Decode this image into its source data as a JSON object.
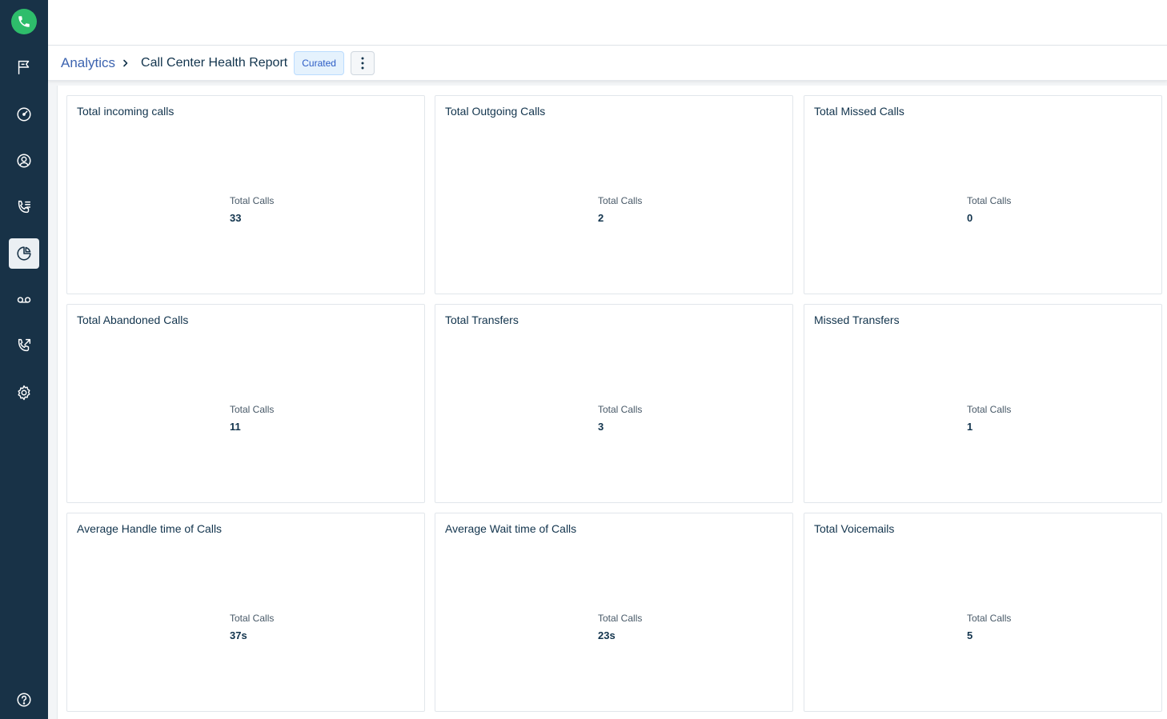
{
  "sidebar": {
    "items": [
      {
        "icon": "flag-icon"
      },
      {
        "icon": "speedometer-icon"
      },
      {
        "icon": "contact-icon"
      },
      {
        "icon": "call-log-icon"
      },
      {
        "icon": "analytics-pie-icon",
        "active": true
      },
      {
        "icon": "voicemail-icon"
      },
      {
        "icon": "call-transfer-icon"
      },
      {
        "icon": "gear-icon"
      }
    ],
    "help_icon": "help-icon"
  },
  "breadcrumb": {
    "parent": "Analytics",
    "current": "Call Center Health Report",
    "badge": "Curated"
  },
  "cards": [
    {
      "title": "Total incoming calls",
      "label": "Total Calls",
      "value": "33"
    },
    {
      "title": "Total Outgoing Calls",
      "label": "Total Calls",
      "value": "2"
    },
    {
      "title": "Total Missed Calls",
      "label": "Total Calls",
      "value": "0"
    },
    {
      "title": "Total Abandoned Calls",
      "label": "Total Calls",
      "value": "11"
    },
    {
      "title": "Total Transfers",
      "label": "Total Calls",
      "value": "3"
    },
    {
      "title": "Missed Transfers",
      "label": "Total Calls",
      "value": "1"
    },
    {
      "title": "Average Handle time of Calls",
      "label": "Total Calls",
      "value": "37s"
    },
    {
      "title": "Average Wait time of Calls",
      "label": "Total Calls",
      "value": "23s"
    },
    {
      "title": "Total Voicemails",
      "label": "Total Calls",
      "value": "5"
    }
  ],
  "colors": {
    "sidebar": "#183247",
    "brand_green": "#2ebd6b",
    "link": "#3d64b0",
    "text": "#12344d"
  }
}
